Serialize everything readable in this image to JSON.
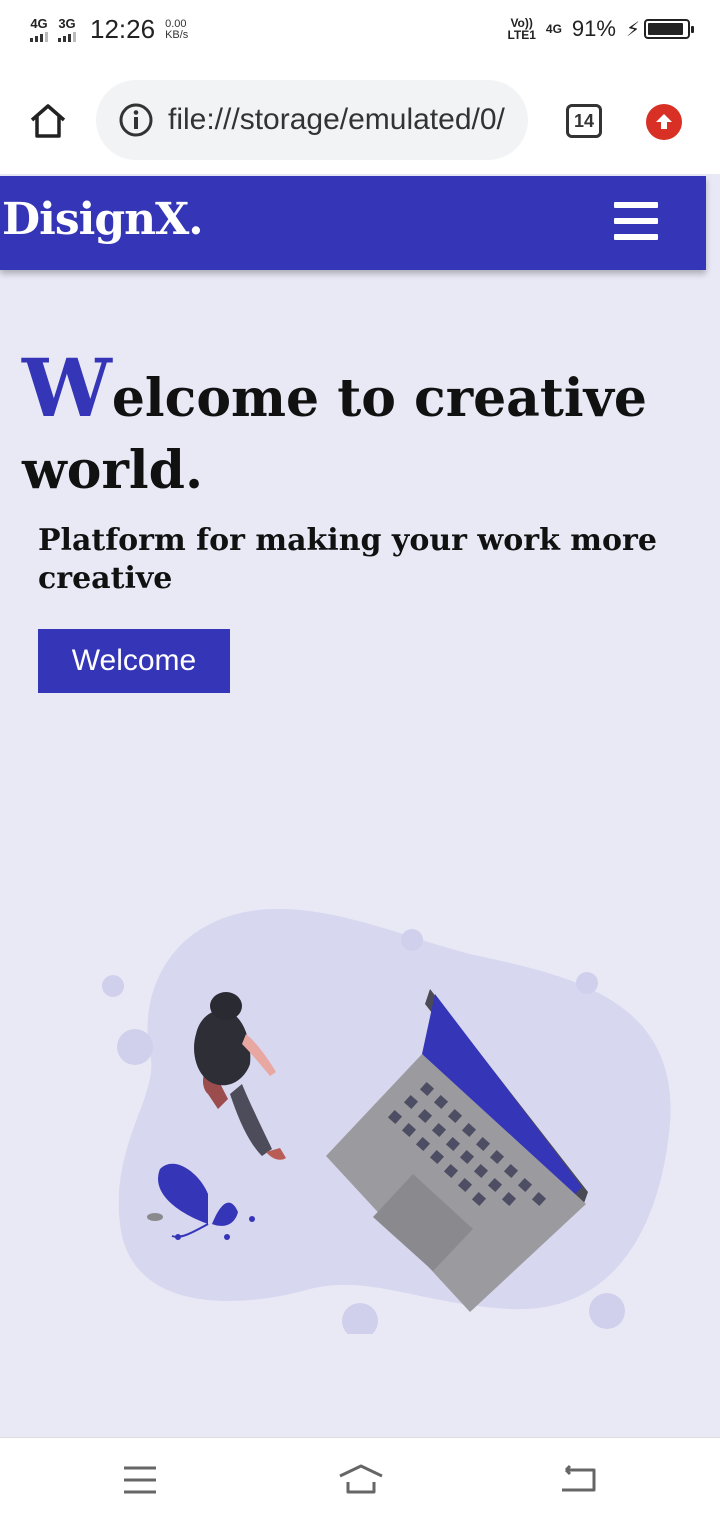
{
  "status_bar": {
    "net1": "4G",
    "net2": "3G",
    "time": "12:26",
    "speed_value": "0.00",
    "speed_unit": "KB/s",
    "volte_top": "Vo))",
    "volte_bottom": "LTE1",
    "net3": "4G",
    "battery": "91%",
    "battery_level": 0.91
  },
  "browser": {
    "url": "file:///storage/emulated/0/",
    "tab_count": "14"
  },
  "site": {
    "brand": "DisignX.",
    "hero_cap": "W",
    "hero_rest": "elcome to creative world.",
    "subtitle": "Platform for making your work more creative",
    "cta": "Welcome"
  },
  "colors": {
    "accent": "#3535b8",
    "page_bg": "#e9e9f6",
    "blob": "#d7d7f0"
  },
  "icons": {
    "home": "home-icon",
    "info": "info-icon",
    "update": "update-icon",
    "menu": "hamburger-icon",
    "nav_menu": "menu-icon",
    "nav_home": "home-icon",
    "nav_back": "back-icon"
  }
}
